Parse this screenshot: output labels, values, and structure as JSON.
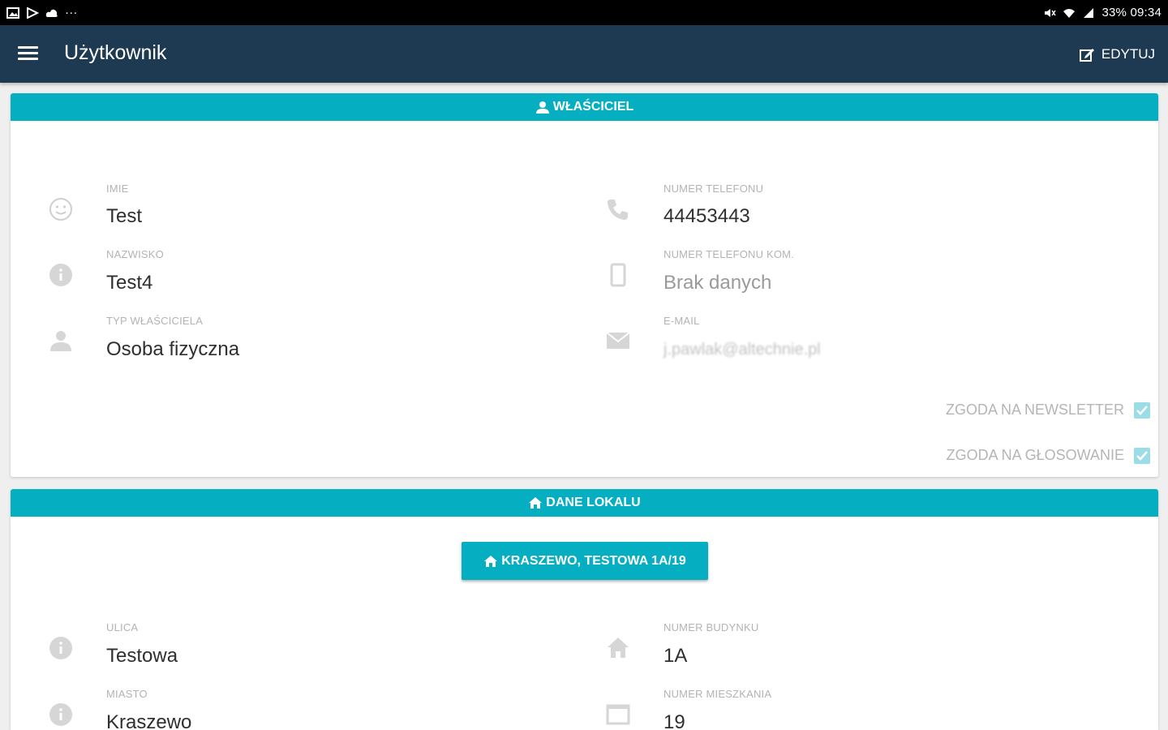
{
  "statusbar": {
    "right_text": "33% 09:34",
    "dots": "···"
  },
  "appbar": {
    "title": "Użytkownik",
    "edit_label": "EDYTUJ"
  },
  "owner": {
    "header": "WŁAŚCICIEL",
    "fields": {
      "imie": {
        "label": "IMIE",
        "value": "Test"
      },
      "nazwisko": {
        "label": "NAZWISKO",
        "value": "Test4"
      },
      "typ": {
        "label": "TYP WŁAŚCICIELA",
        "value": "Osoba fizyczna"
      },
      "telefon": {
        "label": "NUMER TELEFONU",
        "value": "44453443"
      },
      "telefon_kom": {
        "label": "NUMER TELEFONU KOM.",
        "value": "Brak danych"
      },
      "email": {
        "label": "E-MAIL",
        "value": "j.pawlak@altechnie.pl"
      }
    },
    "consents": {
      "newsletter": {
        "label": "ZGODA NA NEWSLETTER",
        "checked": true
      },
      "glosowanie": {
        "label": "ZGODA NA GŁOSOWANIE",
        "checked": true
      }
    }
  },
  "lokal": {
    "header": "DANE LOKALU",
    "address_button": "KRASZEWO, TESTOWA 1A/19",
    "fields": {
      "ulica": {
        "label": "ULICA",
        "value": "Testowa"
      },
      "miasto": {
        "label": "MIASTO",
        "value": "Kraszewo"
      },
      "budynek": {
        "label": "NUMER BUDYNKU",
        "value": "1A"
      },
      "mieszkanie": {
        "label": "NUMER MIESZKANIA",
        "value": "19"
      }
    }
  },
  "colors": {
    "appbar": "#1d3a52",
    "accent": "#06aec1",
    "checkbox": "#9bdce6"
  }
}
